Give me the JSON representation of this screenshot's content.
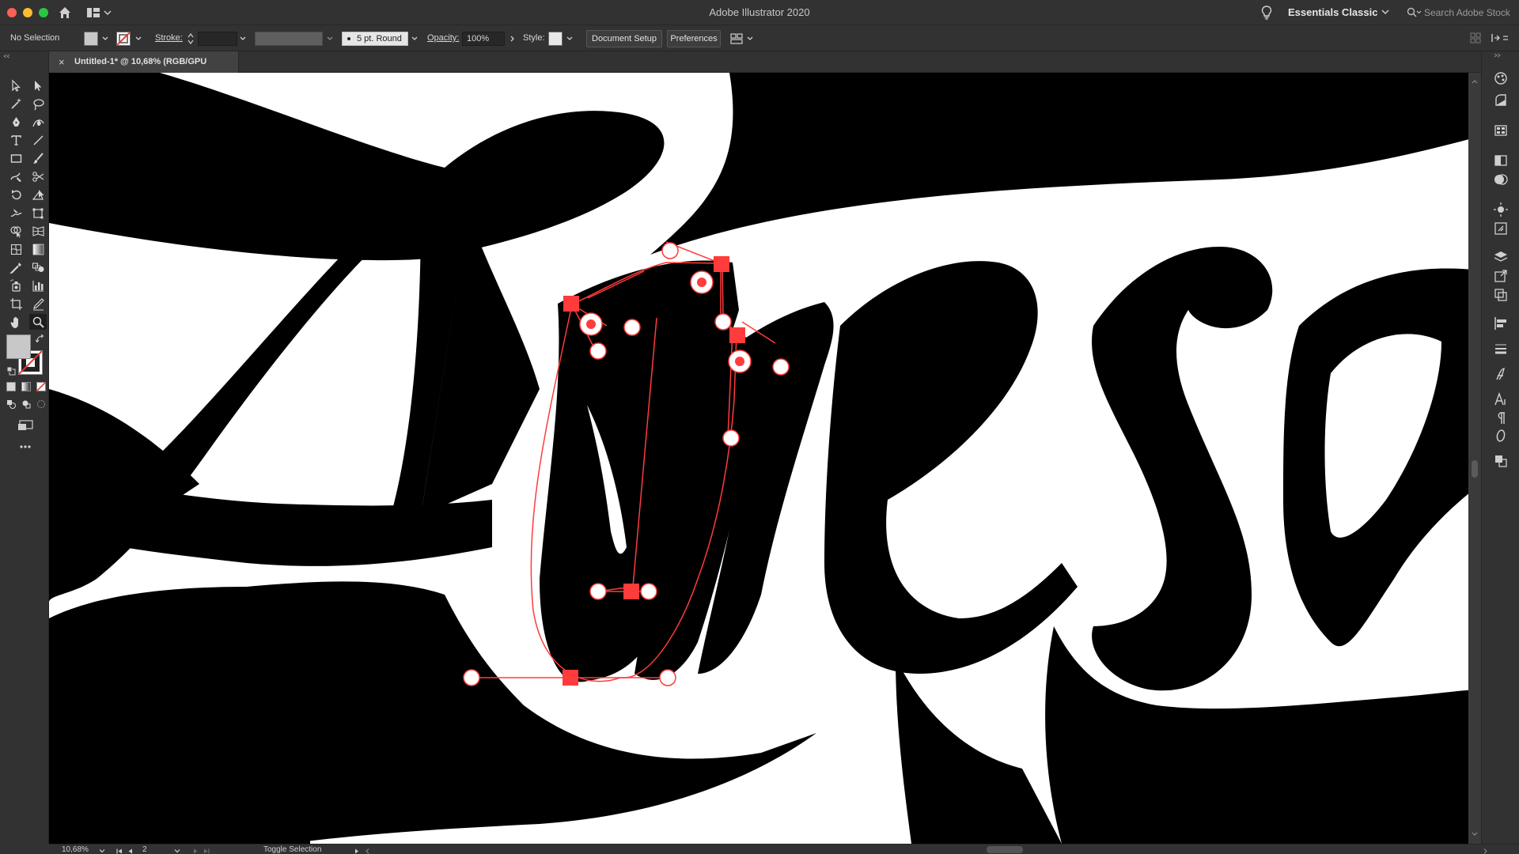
{
  "app": {
    "title": "Adobe Illustrator 2020",
    "workspace": "Essentials Classic",
    "search_placeholder": "Search Adobe Stock"
  },
  "control_bar": {
    "selection_label": "No Selection",
    "stroke_label": "Stroke:",
    "stroke_value": "",
    "brush_value": "5 pt. Round",
    "opacity_label": "Opacity:",
    "opacity_value": "100%",
    "style_label": "Style:",
    "document_setup_label": "Document Setup",
    "preferences_label": "Preferences"
  },
  "document_tab": {
    "close_glyph": "×",
    "title": "Untitled-1* @ 10,68% (RGB/GPU Preview)"
  },
  "status_bar": {
    "zoom": "10,68%",
    "artboard_number": "2",
    "status_text": "Toggle Selection"
  },
  "colors": {
    "anchor": "#ff3b3b",
    "ui_bg": "#323232",
    "accent_stroke": "#ff3b3b"
  },
  "icons": {
    "tools": [
      "selection-tool-icon",
      "direct-selection-tool-icon",
      "magic-wand-tool-icon",
      "lasso-tool-icon",
      "pen-tool-icon",
      "curvature-tool-icon",
      "type-tool-icon",
      "line-tool-icon",
      "rectangle-tool-icon",
      "paintbrush-tool-icon",
      "shaper-tool-icon",
      "scissors-tool-icon",
      "rotate-tool-icon",
      "reshape-tool-icon",
      "warp-tool-icon",
      "free-transform-tool-icon",
      "shape-builder-tool-icon",
      "perspective-grid-tool-icon",
      "mesh-tool-icon",
      "gradient-tool-icon",
      "eyedropper-tool-icon",
      "blend-tool-icon",
      "symbol-sprayer-tool-icon",
      "column-graph-tool-icon",
      "artboard-tool-icon",
      "slice-tool-icon",
      "hand-tool-icon",
      "zoom-tool-icon"
    ]
  }
}
